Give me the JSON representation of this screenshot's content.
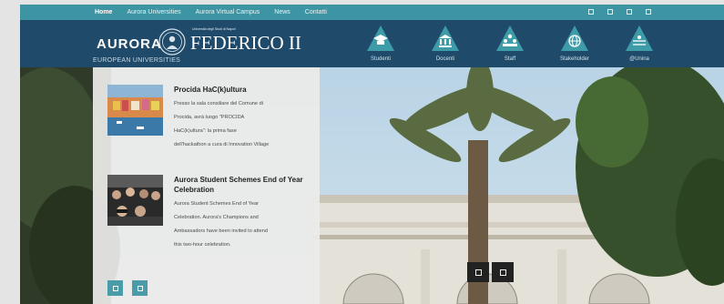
{
  "nav": {
    "items": [
      {
        "label": "Home",
        "active": true
      },
      {
        "label": "Aurora Universities",
        "active": false
      },
      {
        "label": "Aurora Virtual Campus",
        "active": false
      },
      {
        "label": "News",
        "active": false
      },
      {
        "label": "Contatti",
        "active": false
      }
    ]
  },
  "header": {
    "brand": "AURORA",
    "university_small": "Università degli Studi di Napoli",
    "university": "FEDERICO II",
    "tagline": "EUROPEAN UNIVERSITIES",
    "roles": [
      {
        "label": "Studenti",
        "icon": "graduation-cap-icon"
      },
      {
        "label": "Docenti",
        "icon": "building-icon"
      },
      {
        "label": "Staff",
        "icon": "people-icon"
      },
      {
        "label": "Stakeholder",
        "icon": "globe-icon"
      },
      {
        "label": "@Unina",
        "icon": "network-icon"
      }
    ]
  },
  "news": [
    {
      "title": "Procida HaC(k)ultura",
      "text": [
        "Presso la sala consiliare del Comune di",
        "Procida, avrà luogo \"PROCIDA",
        "HaC(k)ultura\": la prima fase",
        "dell'hackathon a cura di Innovation Village"
      ]
    },
    {
      "title": "Aurora Student Schemes End of Year Celebration",
      "text": [
        "Aurora Student Schemes End of Year",
        "Celebration. Aurora's Champions and",
        "Ambassadors have been invited to attend",
        "this two-hour celebration."
      ]
    }
  ],
  "colors": {
    "nav_bg": "#3d95a3",
    "header_bg": "#1f4a6a",
    "accent": "#4a9ca9"
  }
}
